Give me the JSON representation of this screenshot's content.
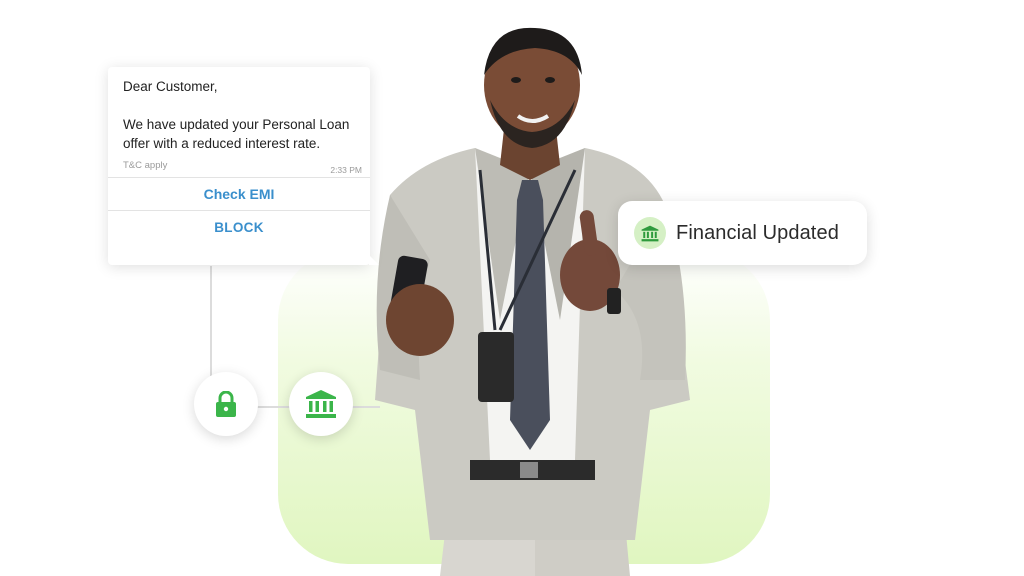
{
  "message": {
    "greeting": "Dear Customer,",
    "body": "We have updated your Personal Loan offer with a reduced interest rate.",
    "terms": "T&C apply",
    "time": "2:33 PM",
    "actions": [
      {
        "label": "Check EMI"
      },
      {
        "label": "BLOCK"
      }
    ]
  },
  "notification": {
    "label": "Financial Updated",
    "icon": "bank-icon"
  },
  "icons": {
    "lock": "lock-icon",
    "bank": "bank-icon"
  },
  "colors": {
    "accent_green": "#3bb54a",
    "link_blue": "#3a8fcc",
    "backdrop_green": "#e0f6c0"
  }
}
